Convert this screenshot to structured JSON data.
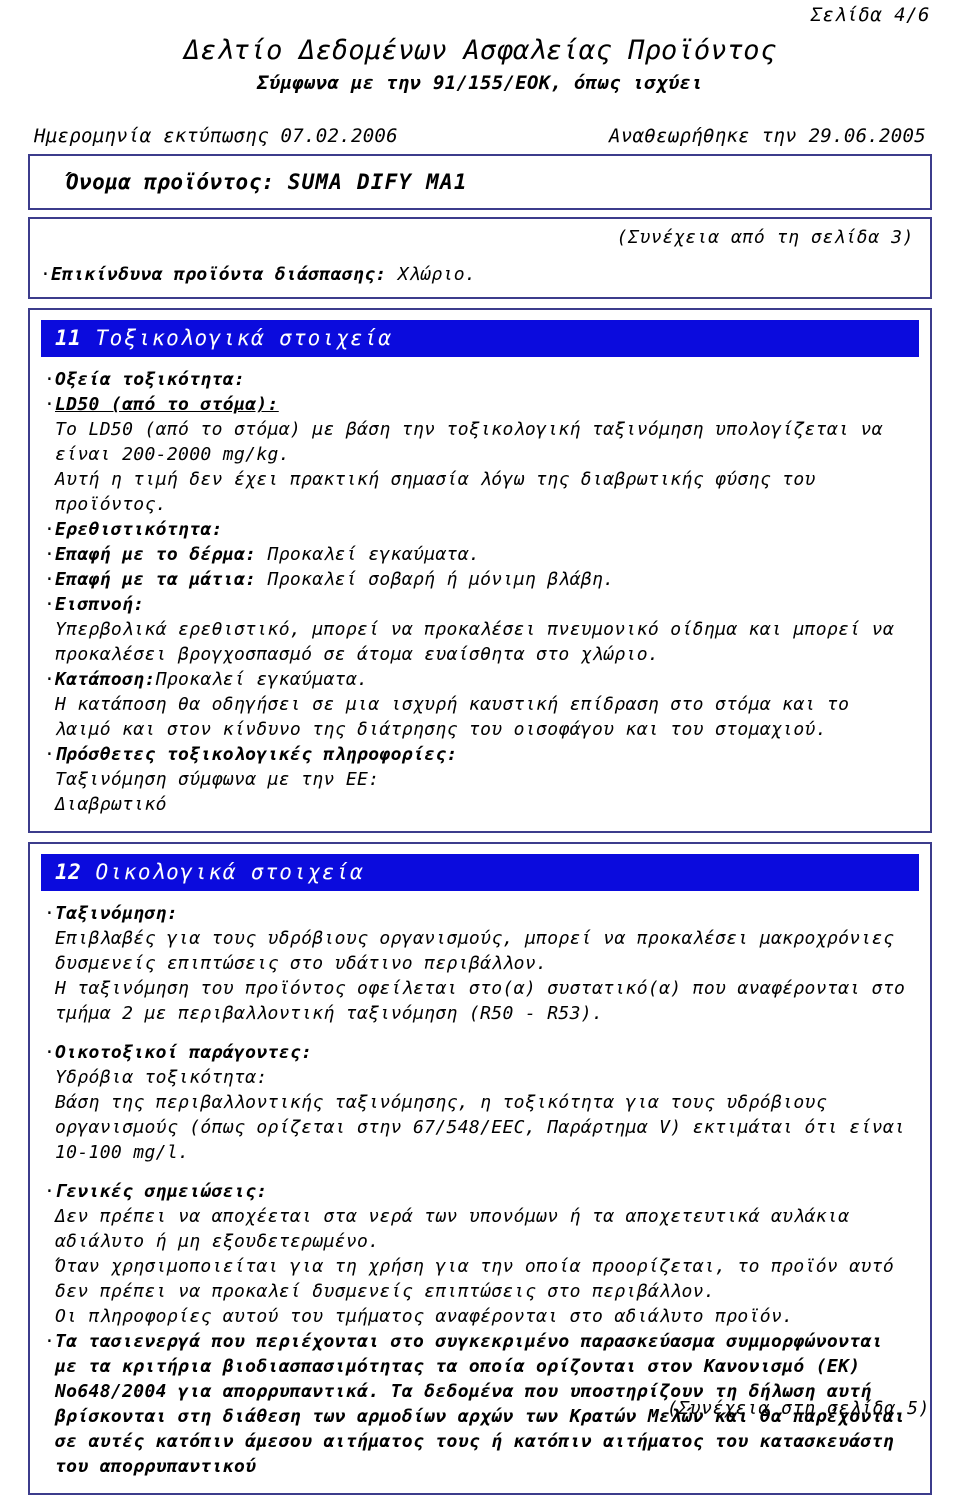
{
  "header": {
    "page_number": "Σελίδα 4/6",
    "title": "Δελτίο Δεδομένων Ασφαλείας Προϊόντος",
    "subtitle": "Σύμφωνα με την 91/155/ΕΟΚ, όπως ισχύει",
    "print_date_label": "Ημερομηνία εκτύπωσης 07.02.2006",
    "revised_label": "Αναθεωρήθηκε την 29.06.2005"
  },
  "product": {
    "label": "Όνομα προϊόντος:",
    "value": "SUMA DIFY MA1"
  },
  "continuation": {
    "from_previous": "(Συνέχεια από τη σελίδα 3)",
    "hazard_label": "Επικίνδυνα προϊόντα διάσπασης:",
    "hazard_value": "Χλώριο."
  },
  "colors": {
    "box_border": "#3c3c8c",
    "section_bar_bg": "#0b0bdd",
    "section_bar_text": "#ffffff",
    "text": "#000000"
  },
  "sections": [
    {
      "number": "11",
      "title": "Τοξικολογικά στοιχεία",
      "items": [
        {
          "kind": "bullet-label",
          "label": "Οξεία τοξικότητα:"
        },
        {
          "kind": "bullet-label-underline",
          "label": "LD50 (από το στόμα):"
        },
        {
          "kind": "text",
          "text": "Το LD50 (από το στόμα) με βάση την τοξικολογική ταξινόμηση υπολογίζεται να"
        },
        {
          "kind": "text",
          "text": "είναι 200-2000 mg/kg."
        },
        {
          "kind": "text",
          "text": "Αυτή η τιμή δεν έχει πρακτική σημασία λόγω της διαβρωτικής φύσης του"
        },
        {
          "kind": "text",
          "text": "προϊόντος."
        },
        {
          "kind": "bullet-label",
          "label": "Ερεθιστικότητα:"
        },
        {
          "kind": "bullet-pair",
          "label": "Επαφή με το δέρμα:",
          "value": "Προκαλεί εγκαύματα."
        },
        {
          "kind": "bullet-pair",
          "label": "Επαφή με τα μάτια:",
          "value": "Προκαλεί σοβαρή ή μόνιμη βλάβη."
        },
        {
          "kind": "bullet-label",
          "label": "Εισπνοή:"
        },
        {
          "kind": "text",
          "text": "Υπερβολικά ερεθιστικό, μπορεί να προκαλέσει πνευμονικό οίδημα και μπορεί να"
        },
        {
          "kind": "text",
          "text": "προκαλέσει βρογχοσπασμό σε άτομα ευαίσθητα στο χλώριο."
        },
        {
          "kind": "bullet-pair-tight",
          "label": "Κατάποση:",
          "value": "Προκαλεί εγκαύματα."
        },
        {
          "kind": "text",
          "text": "Η κατάποση θα οδηγήσει σε μια ισχυρή καυστική επίδραση στο στόμα και το"
        },
        {
          "kind": "text",
          "text": "λαιμό και στον κίνδυνο της διάτρησης του οισοφάγου και του στομαχιού."
        },
        {
          "kind": "bullet-label",
          "label": "Πρόσθετες τοξικολογικές πληροφορίες:"
        },
        {
          "kind": "text",
          "text": "Ταξινόμηση σύμφωνα με την ΕΕ:"
        },
        {
          "kind": "text",
          "text": "Διαβρωτικό"
        }
      ]
    },
    {
      "number": "12",
      "title": "Οικολογικά στοιχεία",
      "items": [
        {
          "kind": "bullet-label",
          "label": "Ταξινόμηση:"
        },
        {
          "kind": "text",
          "text": "Επιβλαβές για τους υδρόβιους οργανισμούς, μπορεί να προκαλέσει μακροχρόνιες"
        },
        {
          "kind": "text",
          "text": "δυσμενείς επιπτώσεις στο υδάτινο περιβάλλον."
        },
        {
          "kind": "text",
          "text": "Η ταξινόμηση του προϊόντος οφείλεται στο(α) συστατικό(α) που αναφέρονται στο"
        },
        {
          "kind": "text",
          "text": "τμήμα 2 με περιβαλλοντική ταξινόμηση (R50 - R53)."
        },
        {
          "kind": "spacer"
        },
        {
          "kind": "bullet-label",
          "label": "Οικοτοξικοί παράγοντες:"
        },
        {
          "kind": "text",
          "text": "Υδρόβια τοξικότητα:"
        },
        {
          "kind": "text",
          "text": "Βάση της περιβαλλοντικής ταξινόμησης, η τοξικότητα για τους υδρόβιους"
        },
        {
          "kind": "text",
          "text": "οργανισμούς (όπως ορίζεται στην 67/548/EEC, Παράρτημα V) εκτιμάται ότι είναι"
        },
        {
          "kind": "text",
          "text": "10-100 mg/l."
        },
        {
          "kind": "spacer"
        },
        {
          "kind": "bullet-label",
          "label": "Γενικές σημειώσεις:"
        },
        {
          "kind": "text",
          "text": "Δεν πρέπει να αποχέεται στα νερά των υπονόμων ή τα αποχετευτικά αυλάκια"
        },
        {
          "kind": "text",
          "text": "αδιάλυτο ή μη εξουδετερωμένο."
        },
        {
          "kind": "text",
          "text": "Όταν χρησιμοποιείται για τη χρήση για την οποία προορίζεται, το προϊόν αυτό"
        },
        {
          "kind": "text",
          "text": "δεν πρέπει να προκαλεί δυσμενείς επιπτώσεις στο περιβάλλον."
        },
        {
          "kind": "text",
          "text": "Οι πληροφορίες αυτού του τμήματος αναφέρονται στο αδιάλυτο προϊόν."
        },
        {
          "kind": "bullet-bold",
          "text": "Τα τασιενεργά που περιέχονται στο συγκεκριμένο παρασκεύασμα συμμορφώνονται"
        },
        {
          "kind": "bold",
          "text": "με τα κριτήρια βιοδιασπασιμότητας τα οποία ορίζονται στον Κανονισμό (ΕΚ)"
        },
        {
          "kind": "bold",
          "text": "Νο648/2004 για απορρυπαντικά. Τα δεδομένα που υποστηρίζουν τη δήλωση αυτή"
        },
        {
          "kind": "bold",
          "text": "βρίσκονται στη διάθεση των αρμοδίων αρχών των Κρατών Μελών και θα παρέχονται"
        },
        {
          "kind": "bold",
          "text": "σε αυτές κατόπιν άμεσου αιτήματος τους ή κατόπιν αιτήματος του κατασκευάστη"
        },
        {
          "kind": "bold",
          "text": "του απορρυπαντικού"
        }
      ]
    }
  ],
  "footer": {
    "continued_next": "(Συνέχεια στη σελίδα 5)"
  }
}
